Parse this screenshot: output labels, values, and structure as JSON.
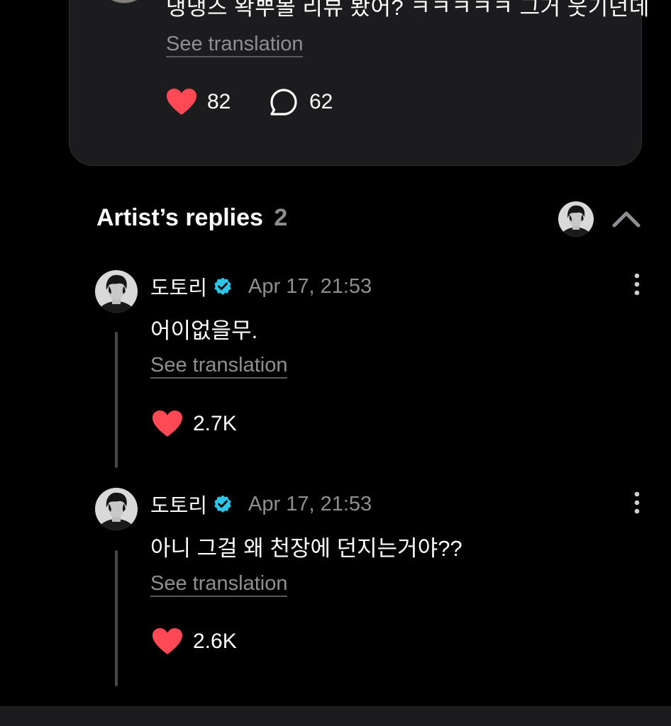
{
  "post": {
    "text": "댕댕즈 왁뿌볼 리뷰 봤어? ㅋㅋㅋㅋㅋ 그거 웃기던데",
    "see_translation": "See translation",
    "likes": "82",
    "comments": "62"
  },
  "artist_replies": {
    "title": "Artist’s replies",
    "count": "2"
  },
  "replies": [
    {
      "name": "도토리",
      "time": "Apr 17, 21:53",
      "text": "어이없을무.",
      "see_translation": "See translation",
      "likes": "2.7K"
    },
    {
      "name": "도토리",
      "time": "Apr 17, 21:53",
      "text": "아니 그걸 왜 천장에 던지는거야??",
      "see_translation": "See translation",
      "likes": "2.6K"
    }
  ],
  "colors": {
    "background": "#000000",
    "card": "#1c1c1e",
    "heart": "#ff4a55",
    "verified": "#2ec4e6",
    "muted_text": "#8e8e93",
    "thread_line": "#48484a"
  },
  "icons": {
    "like": "heart-icon",
    "comment": "speech-bubble-icon",
    "verified": "verified-badge-icon",
    "collapse": "chevron-up-icon",
    "more": "vertical-dots-icon"
  }
}
